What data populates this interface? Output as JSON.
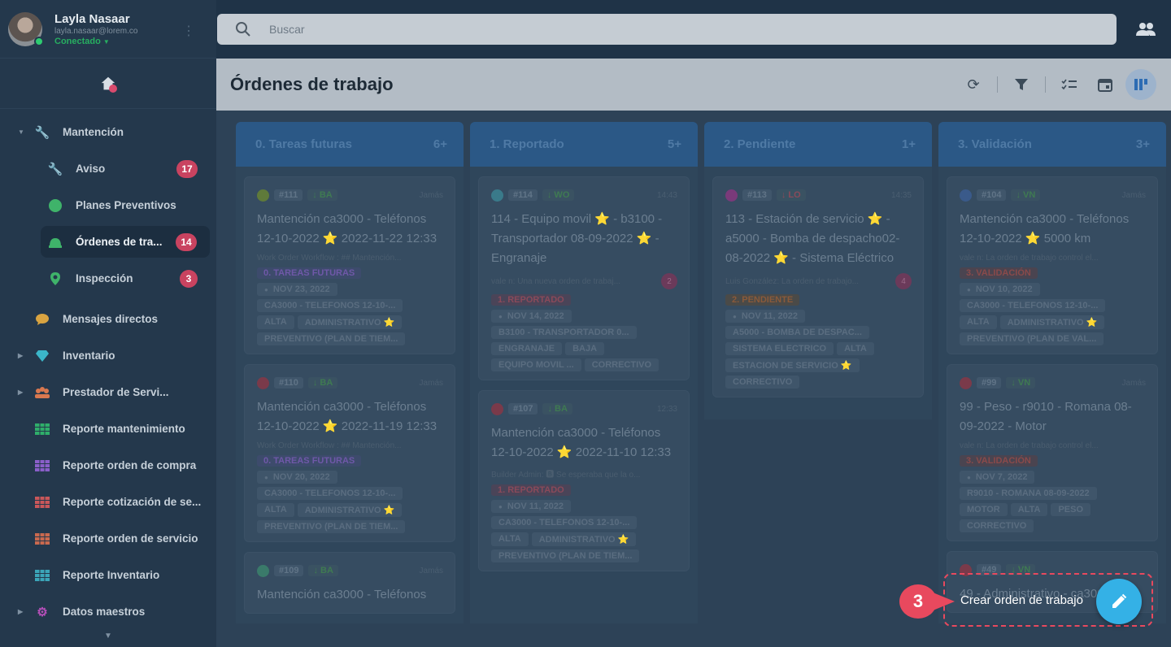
{
  "user": {
    "name": "Layla Nasaar",
    "email": "layla.nasaar@lorem.co",
    "status": "Conectado"
  },
  "search": {
    "placeholder": "Buscar"
  },
  "sidebar": {
    "items": [
      {
        "label": "Mantención",
        "icon": "wrench-icon"
      },
      {
        "label": "Aviso",
        "icon": "wrench-icon",
        "badge": "17"
      },
      {
        "label": "Planes Preventivos",
        "icon": "clock-icon"
      },
      {
        "label": "Órdenes de tra...",
        "icon": "helmet-icon",
        "badge": "14"
      },
      {
        "label": "Inspección",
        "icon": "map-pin-icon",
        "badge": "3"
      },
      {
        "label": "Mensajes directos",
        "icon": "chat-icon"
      },
      {
        "label": "Inventario",
        "icon": "diamond-icon"
      },
      {
        "label": "Prestador de Servi...",
        "icon": "group-icon"
      },
      {
        "label": "Reporte mantenimiento",
        "icon": "grid-icon"
      },
      {
        "label": "Reporte orden de compra",
        "icon": "grid-icon"
      },
      {
        "label": "Reporte cotización de se...",
        "icon": "grid-icon"
      },
      {
        "label": "Reporte orden de servicio",
        "icon": "grid-icon"
      },
      {
        "label": "Reporte Inventario",
        "icon": "grid-icon"
      },
      {
        "label": "Datos maestros",
        "icon": "gear-icon"
      }
    ]
  },
  "page": {
    "title": "Órdenes de trabajo"
  },
  "columns": [
    {
      "title": "0. Tareas futuras",
      "count": "6+",
      "cards": [
        {
          "id": "#111",
          "prio": "↓ BA",
          "date": "Jamás",
          "title": "Mantención ca3000 - Teléfonos 12-10-2022 ⭐ 2022-11-22 12:33",
          "desc": "Work Order Workflow : ## Mantención...",
          "state": "0. TAREAS FUTURAS",
          "due": "NOV 23, 2022",
          "chips": [
            "CA3000 - TELEFONOS 12-10-...",
            "ALTA",
            "ADMINISTRATIVO ⭐",
            "PREVENTIVO (PLAN DE TIEM..."
          ]
        },
        {
          "id": "#110",
          "prio": "↓ BA",
          "date": "Jamás",
          "title": "Mantención ca3000 - Teléfonos 12-10-2022 ⭐ 2022-11-19 12:33",
          "desc": "Work Order Workflow : ## Mantención...",
          "state": "0. TAREAS FUTURAS",
          "due": "NOV 20, 2022",
          "chips": [
            "CA3000 - TELEFONOS 12-10-...",
            "ALTA",
            "ADMINISTRATIVO ⭐",
            "PREVENTIVO (PLAN DE TIEM..."
          ]
        },
        {
          "id": "#109",
          "prio": "↓ BA",
          "date": "Jamás",
          "title": "Mantención ca3000 - Teléfonos",
          "desc": "",
          "state": "",
          "due": "",
          "chips": []
        }
      ]
    },
    {
      "title": "1. Reportado",
      "count": "5+",
      "cards": [
        {
          "id": "#114",
          "prio": "↓ WO",
          "date": "14:43",
          "title": "114 - Equipo movil ⭐ - b3100 - Transportador 08-09-2022 ⭐ - Engranaje",
          "desc": "vale n: Una nueva orden de trabaj...",
          "count": "2",
          "state": "1. REPORTADO",
          "due": "NOV 14, 2022",
          "chips": [
            "B3100 - TRANSPORTADOR 0...",
            "ENGRANAJE",
            "BAJA",
            "EQUIPO MOVIL ...",
            "CORRECTIVO"
          ]
        },
        {
          "id": "#107",
          "prio": "↓ BA",
          "date": "12:33",
          "title": "Mantención ca3000 - Teléfonos 12-10-2022 ⭐ 2022-11-10 12:33",
          "desc": "Builder Admin: 🅱 Se esperaba que la o...",
          "state": "1. REPORTADO",
          "due": "NOV 11, 2022",
          "chips": [
            "CA3000 - TELEFONOS 12-10-...",
            "ALTA",
            "ADMINISTRATIVO ⭐",
            "PREVENTIVO (PLAN DE TIEM..."
          ]
        }
      ]
    },
    {
      "title": "2. Pendiente",
      "count": "1+",
      "cards": [
        {
          "id": "#113",
          "prio": "↓ LO",
          "date": "14:35",
          "title": "113 - Estación de servicio ⭐ - a5000 - Bomba de despacho02-08-2022 ⭐ - Sistema Eléctrico",
          "desc": "Luis González: La orden de trabajo...",
          "count": "4",
          "state": "2. PENDIENTE",
          "due": "NOV 11, 2022",
          "chips": [
            "A5000 - BOMBA DE DESPAC...",
            "SISTEMA ELECTRICO",
            "ALTA",
            "ESTACION DE SERVICIO ⭐",
            "CORRECTIVO"
          ]
        }
      ]
    },
    {
      "title": "3. Validación",
      "count": "3+",
      "cards": [
        {
          "id": "#104",
          "prio": "↓ VN",
          "date": "Jamás",
          "title": "Mantención ca3000 - Teléfonos 12-10-2022 ⭐ 5000 km",
          "desc": "vale n: La orden de trabajo control el...",
          "state": "3. VALIDACIÓN",
          "due": "NOV 10, 2022",
          "chips": [
            "CA3000 - TELEFONOS 12-10-...",
            "ALTA",
            "ADMINISTRATIVO ⭐",
            "PREVENTIVO (PLAN DE VAL..."
          ]
        },
        {
          "id": "#99",
          "prio": "↓ VN",
          "date": "Jamás",
          "title": "99 - Peso - r9010 - Romana 08-09-2022 - Motor",
          "desc": "vale n: La orden de trabajo control el...",
          "state": "3. VALIDACIÓN",
          "due": "NOV 7, 2022",
          "chips": [
            "R9010 - ROMANA 08-09-2022",
            "MOTOR",
            "ALTA",
            "PESO",
            "CORRECTIVO"
          ]
        },
        {
          "id": "#49",
          "prio": "↓ VN",
          "date": "",
          "title": "49 - Administrativo - ca3000",
          "desc": "",
          "state": "",
          "due": "",
          "chips": []
        }
      ]
    }
  ],
  "cta": {
    "label": "Crear orden de trabajo",
    "step": "3"
  },
  "colors": {
    "accent": "#34b1e6",
    "highlight": "#e8495e",
    "columnHeader": "#2b5886"
  }
}
